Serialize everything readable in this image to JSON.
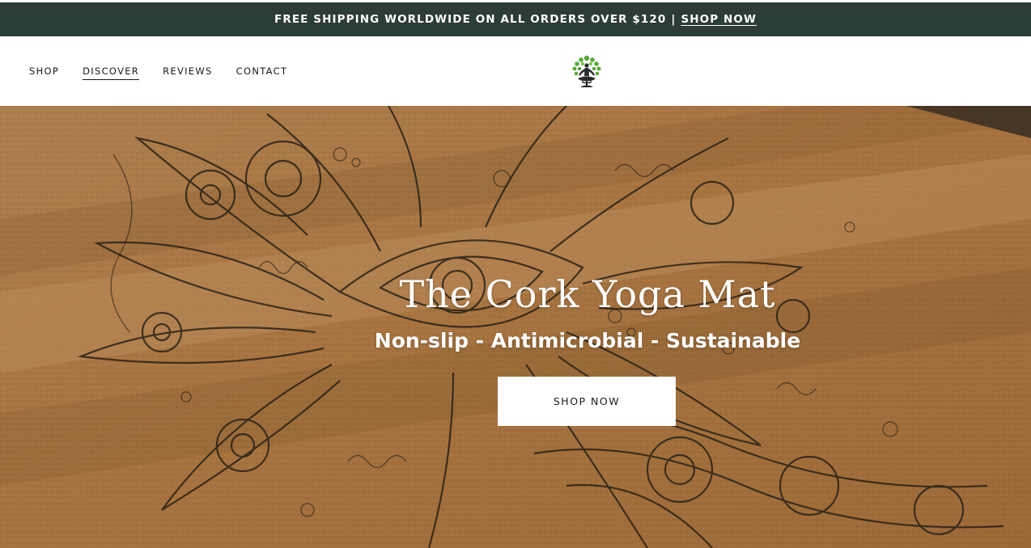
{
  "announcement": {
    "text": "FREE SHIPPING WORLDWIDE ON ALL ORDERS OVER $120",
    "separator": "|",
    "link": "SHOP NOW",
    "background": "#2c3c37"
  },
  "nav": {
    "items": [
      {
        "label": "SHOP",
        "active": false
      },
      {
        "label": "DISCOVER",
        "active": true
      },
      {
        "label": "REVIEWS",
        "active": false
      },
      {
        "label": "CONTACT",
        "active": false
      }
    ]
  },
  "logo": {
    "icon": "yoga-tree-logo",
    "colors": {
      "leaves": "#5aa83c",
      "figure": "#2a2a2a"
    }
  },
  "hero": {
    "title": "The Cork Yoga Mat",
    "subtitle": "Non-slip - Antimicrobial - Sustainable",
    "button": "SHOP NOW",
    "image": "cork-mandala-mat"
  }
}
